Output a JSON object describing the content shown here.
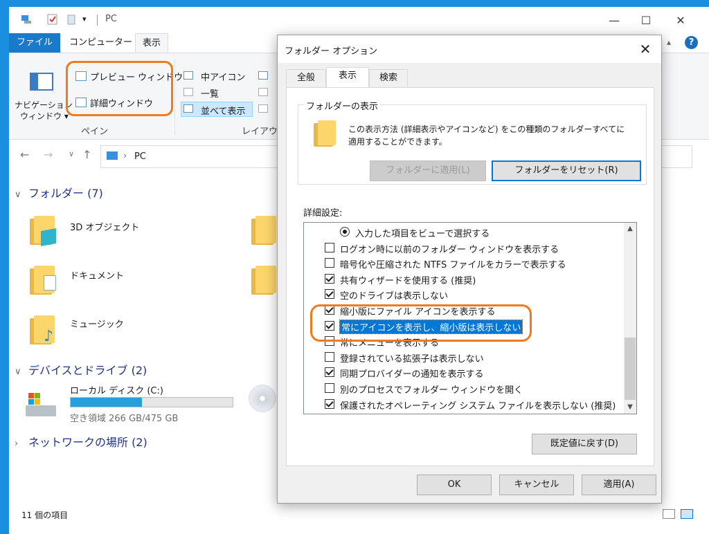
{
  "explorer": {
    "window_title": "PC",
    "tabs": [
      "ファイル",
      "コンピューター",
      "表示"
    ],
    "ribbon": {
      "nav_pane_label_1": "ナビゲーション",
      "nav_pane_label_2": "ウィンドウ",
      "preview_pane": "プレビュー ウィンドウ",
      "details_pane": "詳細ウィンドウ",
      "pane_group": "ペイン",
      "medium_icons": "中アイコン",
      "list": "一覧",
      "tiles": "並べて表示",
      "layout_group": "レイアウト"
    },
    "address": "PC",
    "sections": {
      "folders": "フォルダー (7)",
      "devices": "デバイスとドライブ (2)",
      "network": "ネットワークの場所 (2)"
    },
    "items": {
      "objects3d": "3D オブジェクト",
      "documents": "ドキュメント",
      "music": "ミュージック"
    },
    "drive": {
      "name": "ローカル ディスク (C:)",
      "free_text": "空き領域 266 GB/475 GB",
      "used_fraction": 0.44
    },
    "status": "11 個の項目"
  },
  "dialog": {
    "title": "フォルダー オプション",
    "tabs": [
      "全般",
      "表示",
      "検索"
    ],
    "folder_view_group": "フォルダーの表示",
    "folder_view_desc_1": "この表示方法 (詳細表示やアイコンなど) をこの種類のフォルダーすべてに",
    "folder_view_desc_2": "適用することができます。",
    "apply_to_folders": "フォルダーに適用(L)",
    "reset_folders": "フォルダーをリセット(R)",
    "advanced_label": "詳細設定:",
    "options": [
      {
        "type": "radio",
        "label": "入力した項目をビューで選択する",
        "checked": true
      },
      {
        "type": "check",
        "label": "ログオン時に以前のフォルダー ウィンドウを表示する",
        "checked": false
      },
      {
        "type": "check",
        "label": "暗号化や圧縮された NTFS ファイルをカラーで表示する",
        "checked": false
      },
      {
        "type": "check",
        "label": "共有ウィザードを使用する (推奨)",
        "checked": true
      },
      {
        "type": "check",
        "label": "空のドライブは表示しない",
        "checked": true
      },
      {
        "type": "check",
        "label": "縮小版にファイル アイコンを表示する",
        "checked": true
      },
      {
        "type": "check",
        "label": "常にアイコンを表示し、縮小版は表示しない",
        "checked": true,
        "selected": true
      },
      {
        "type": "check",
        "label": "常にメニューを表示する",
        "checked": false
      },
      {
        "type": "check",
        "label": "登録されている拡張子は表示しない",
        "checked": false
      },
      {
        "type": "check",
        "label": "同期プロバイダーの通知を表示する",
        "checked": true
      },
      {
        "type": "check",
        "label": "別のプロセスでフォルダー ウィンドウを開く",
        "checked": false
      },
      {
        "type": "check",
        "label": "保護されたオペレーティング システム ファイルを表示しない (推奨)",
        "checked": true
      }
    ],
    "restore_defaults": "既定値に戻す(D)",
    "ok": "OK",
    "cancel": "キャンセル",
    "apply": "適用(A)"
  },
  "colors": {
    "accent": "#0078d7",
    "highlight": "#f07b1b",
    "file_tab": "#1979ca"
  }
}
